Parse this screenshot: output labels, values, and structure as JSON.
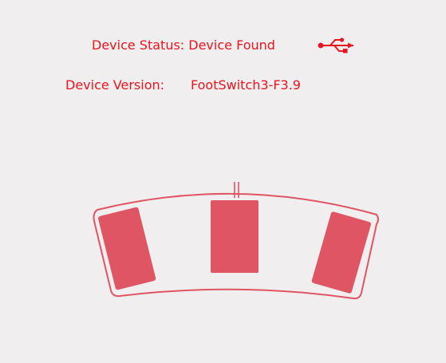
{
  "status": {
    "text": "Device Status: Device Found",
    "icon": "usb-icon"
  },
  "version": {
    "label": "Device Version:",
    "value": "FootSwitch3-F3.9"
  },
  "footswitch": {
    "icon": "footswitch-icon",
    "pedals": [
      "left-pedal",
      "middle-pedal",
      "right-pedal"
    ]
  },
  "colors": {
    "text": "#e8141e",
    "pedal": "#e05563",
    "outline": "#e05563",
    "background": "#f0eeef"
  }
}
